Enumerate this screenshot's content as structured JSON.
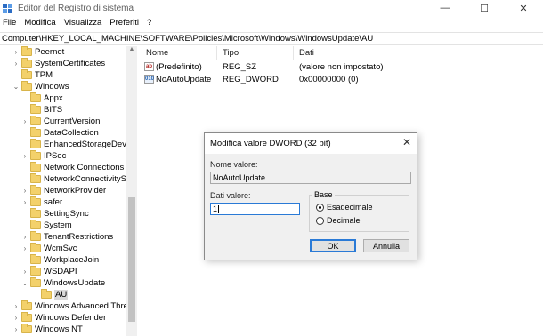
{
  "window": {
    "title": "Editor del Registro di sistema",
    "controls": {
      "minimize": "—",
      "maximize": "☐",
      "close": "✕"
    }
  },
  "menu": [
    "File",
    "Modifica",
    "Visualizza",
    "Preferiti",
    "?"
  ],
  "address": "Computer\\HKEY_LOCAL_MACHINE\\SOFTWARE\\Policies\\Microsoft\\Windows\\WindowsUpdate\\AU",
  "tree": [
    {
      "label": "Peernet",
      "arrow": ">"
    },
    {
      "label": "SystemCertificates",
      "arrow": ">"
    },
    {
      "label": "TPM",
      "arrow": ""
    },
    {
      "label": "Windows",
      "arrow": "v"
    },
    {
      "label": "Appx",
      "arrow": ""
    },
    {
      "label": "BITS",
      "arrow": ""
    },
    {
      "label": "CurrentVersion",
      "arrow": ">"
    },
    {
      "label": "DataCollection",
      "arrow": ""
    },
    {
      "label": "EnhancedStorageDevices",
      "arrow": ""
    },
    {
      "label": "IPSec",
      "arrow": ">"
    },
    {
      "label": "Network Connections",
      "arrow": ""
    },
    {
      "label": "NetworkConnectivityStatusIndicator",
      "arrow": ""
    },
    {
      "label": "NetworkProvider",
      "arrow": ">"
    },
    {
      "label": "safer",
      "arrow": ">"
    },
    {
      "label": "SettingSync",
      "arrow": ""
    },
    {
      "label": "System",
      "arrow": ""
    },
    {
      "label": "TenantRestrictions",
      "arrow": ">"
    },
    {
      "label": "WcmSvc",
      "arrow": ">"
    },
    {
      "label": "WorkplaceJoin",
      "arrow": ""
    },
    {
      "label": "WSDAPI",
      "arrow": ">"
    },
    {
      "label": "WindowsUpdate",
      "arrow": "v"
    },
    {
      "label": "AU",
      "arrow": ""
    },
    {
      "label": "Windows Advanced Threat Protection",
      "arrow": ">"
    },
    {
      "label": "Windows Defender",
      "arrow": ">"
    },
    {
      "label": "Windows NT",
      "arrow": ">"
    }
  ],
  "list": {
    "headers": {
      "name": "Nome",
      "type": "Tipo",
      "data": "Dati"
    },
    "rows": [
      {
        "icon": "ab",
        "name": "(Predefinito)",
        "type": "REG_SZ",
        "data": "(valore non impostato)"
      },
      {
        "icon": "010",
        "name": "NoAutoUpdate",
        "type": "REG_DWORD",
        "data": "0x00000000 (0)"
      }
    ]
  },
  "dialog": {
    "title": "Modifica valore DWORD (32 bit)",
    "close": "✕",
    "name_label": "Nome valore:",
    "name_value": "NoAutoUpdate",
    "data_label": "Dati valore:",
    "data_value": "1",
    "base_label": "Base",
    "hex_label": "Esadecimale",
    "dec_label": "Decimale",
    "ok": "OK",
    "cancel": "Annulla"
  }
}
